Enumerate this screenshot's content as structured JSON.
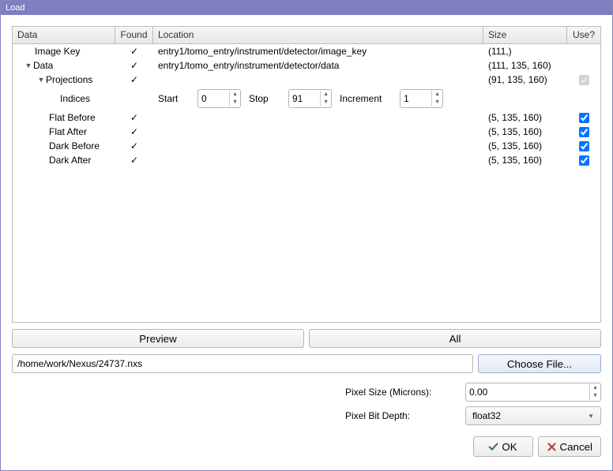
{
  "window": {
    "title": "Load"
  },
  "columns": {
    "data": "Data",
    "found": "Found",
    "location": "Location",
    "size": "Size",
    "use": "Use?"
  },
  "rows": {
    "image_key": {
      "label": "Image Key",
      "found": "✓",
      "location": "entry1/tomo_entry/instrument/detector/image_key",
      "size": "(111,)"
    },
    "data": {
      "label": "Data",
      "found": "✓",
      "location": "entry1/tomo_entry/instrument/detector/data",
      "size": "(111, 135, 160)"
    },
    "projections": {
      "label": "Projections",
      "found": "✓",
      "location": "",
      "size": "(91, 135, 160)"
    },
    "indices": {
      "label": "Indices",
      "start_label": "Start",
      "stop_label": "Stop",
      "inc_label": "Increment",
      "start": "0",
      "stop": "91",
      "inc": "1"
    },
    "flat_before": {
      "label": "Flat Before",
      "found": "✓",
      "size": "(5, 135, 160)"
    },
    "flat_after": {
      "label": "Flat After",
      "found": "✓",
      "size": "(5, 135, 160)"
    },
    "dark_before": {
      "label": "Dark Before",
      "found": "✓",
      "size": "(5, 135, 160)"
    },
    "dark_after": {
      "label": "Dark After",
      "found": "✓",
      "size": "(5, 135, 160)"
    }
  },
  "buttons": {
    "preview": "Preview",
    "all": "All",
    "choose": "Choose File...",
    "ok": "OK",
    "cancel": "Cancel"
  },
  "path": "/home/work/Nexus/24737.nxs",
  "form": {
    "pixel_size_label": "Pixel Size (Microns):",
    "pixel_size": "0.00",
    "bit_depth_label": "Pixel Bit Depth:",
    "bit_depth": "float32"
  }
}
